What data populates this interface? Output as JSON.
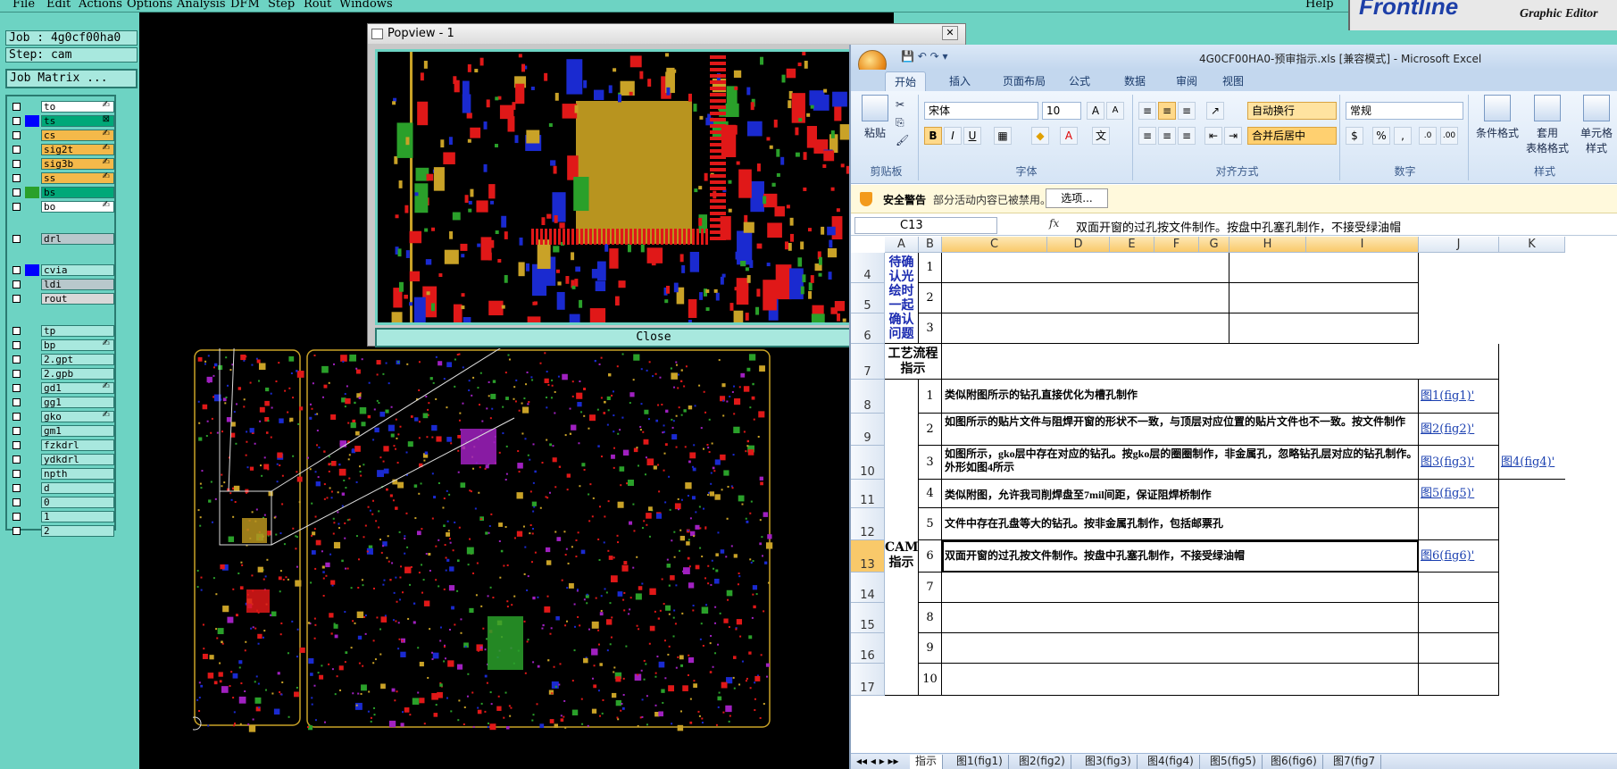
{
  "cam": {
    "menu": [
      "File",
      "Edit",
      "Actions",
      "Options",
      "Analysis",
      "DFM",
      "Step",
      "Rout",
      "Windows"
    ],
    "help": "Help",
    "brand": {
      "logo": "Frontline",
      "subtitle": "Graphic Editor"
    },
    "job_label": "Job : 4g0cf00ha0",
    "step_label": "Step: cam",
    "job_matrix": "Job Matrix ...",
    "layers": [
      {
        "name": "to",
        "color": "#ffffff",
        "mark": "✍"
      },
      {
        "name": "ts",
        "color": "#00a878",
        "mark": "⊠"
      },
      {
        "name": "cs",
        "color": "#f4b94a",
        "mark": "✍"
      },
      {
        "name": "sig2t",
        "color": "#f4b94a",
        "mark": "✍"
      },
      {
        "name": "sig3b",
        "color": "#f4b94a",
        "mark": "✍"
      },
      {
        "name": "ss",
        "color": "#f4b94a",
        "mark": "✍"
      },
      {
        "name": "bs",
        "color": "#00a878",
        "mark": ""
      },
      {
        "name": "bo",
        "color": "#ffffff",
        "mark": "✍"
      },
      {
        "name": "drl",
        "color": "#b8c8cc",
        "mark": ""
      },
      {
        "name": "cvia",
        "color": "#a8e8de",
        "mark": ""
      },
      {
        "name": "ldi",
        "color": "#b8c8cc",
        "mark": ""
      },
      {
        "name": "rout",
        "color": "#d8d8d8",
        "mark": ""
      },
      {
        "name": "tp",
        "color": "#a8e8de",
        "mark": ""
      },
      {
        "name": "bp",
        "color": "#a8e8de",
        "mark": "✍"
      },
      {
        "name": "2.gpt",
        "color": "#a8e8de",
        "mark": ""
      },
      {
        "name": "2.gpb",
        "color": "#a8e8de",
        "mark": ""
      },
      {
        "name": "gd1",
        "color": "#a8e8de",
        "mark": "✍"
      },
      {
        "name": "gg1",
        "color": "#a8e8de",
        "mark": ""
      },
      {
        "name": "gko",
        "color": "#a8e8de",
        "mark": "✍"
      },
      {
        "name": "gm1",
        "color": "#a8e8de",
        "mark": ""
      },
      {
        "name": "fzkdrl",
        "color": "#a8e8de",
        "mark": ""
      },
      {
        "name": "ydkdrl",
        "color": "#a8e8de",
        "mark": ""
      },
      {
        "name": "npth",
        "color": "#a8e8de",
        "mark": ""
      },
      {
        "name": "d",
        "color": "#a8e8de",
        "mark": ""
      },
      {
        "name": "0",
        "color": "#a8e8de",
        "mark": ""
      },
      {
        "name": "1",
        "color": "#a8e8de",
        "mark": ""
      },
      {
        "name": "2",
        "color": "#a8e8de",
        "mark": ""
      }
    ],
    "popview": {
      "title": "Popview - 1",
      "close": "Close"
    }
  },
  "excel": {
    "title": "4G0CF00HA0-预审指示.xls  [兼容模式]  -  Microsoft Excel",
    "tabs": [
      "开始",
      "插入",
      "页面布局",
      "公式",
      "数据",
      "审阅",
      "视图"
    ],
    "ribbon": {
      "clipboard": {
        "paste": "粘贴",
        "label": "剪贴板"
      },
      "font": {
        "name": "宋体",
        "size": "10",
        "label": "字体"
      },
      "align": {
        "wrap": "自动换行",
        "merge": "合并后居中",
        "label": "对齐方式"
      },
      "number": {
        "format": "常规",
        "label": "数字"
      },
      "styles": {
        "cond": "条件格式",
        "table1": "套用",
        "table2": "表格格式",
        "cell1": "单元格",
        "cell2": "样式",
        "label": "样式"
      }
    },
    "security": {
      "title": "安全警告",
      "text": "部分活动内容已被禁用。",
      "button": "选项..."
    },
    "formula": {
      "cell": "C13",
      "fx": "fx",
      "value": "双面开窗的过孔按文件制作。按盘中孔塞孔制作，不接受绿油帽"
    },
    "columns": [
      "A",
      "B",
      "C",
      "D",
      "E",
      "F",
      "G",
      "H",
      "I",
      "J",
      "K"
    ],
    "rows": {
      "numbers": [
        "4",
        "5",
        "6",
        "7",
        "8",
        "9",
        "10",
        "11",
        "12",
        "13",
        "14",
        "15",
        "16",
        "17"
      ],
      "confirm_label": "待确认光绘时一起确认问题",
      "confirm_nums": [
        "1",
        "2",
        "3"
      ],
      "process_label": "工艺流程指示",
      "cam_label": "CAM指示",
      "cam_items": [
        {
          "n": "1",
          "text": "类似附图所示的钻孔直接优化为槽孔制作",
          "link": "图1(fig1)'",
          "link2": ""
        },
        {
          "n": "2",
          "text": "如图所示的贴片文件与阻焊开窗的形状不一致，与顶层对应位置的贴片文件也不一致。按文件制作",
          "link": "图2(fig2)'",
          "link2": ""
        },
        {
          "n": "3",
          "text": "如图所示，gko层中存在对应的钻孔。按gko层的圈圈制作，非金属孔，忽略钻孔层对应的钻孔制作。外形如图4所示",
          "link": "图3(fig3)'",
          "link2": "图4(fig4)'"
        },
        {
          "n": "4",
          "text": "类似附图，允许我司削焊盘至7mil间距，保证阻焊桥制作",
          "link": "图5(fig5)'",
          "link2": ""
        },
        {
          "n": "5",
          "text": "文件中存在孔盘等大的钻孔。按非金属孔制作，包括邮票孔",
          "link": "",
          "link2": ""
        },
        {
          "n": "6",
          "text": "双面开窗的过孔按文件制作。按盘中孔塞孔制作，不接受绿油帽",
          "link": "图6(fig6)'",
          "link2": ""
        },
        {
          "n": "7",
          "text": "",
          "link": "",
          "link2": ""
        },
        {
          "n": "8",
          "text": "",
          "link": "",
          "link2": ""
        },
        {
          "n": "9",
          "text": "",
          "link": "",
          "link2": ""
        },
        {
          "n": "10",
          "text": "",
          "link": "",
          "link2": ""
        }
      ]
    },
    "sheet_tabs": [
      "指示",
      "图1(fig1)",
      "图2(fig2)",
      "图3(fig3)",
      "图4(fig4)",
      "图5(fig5)",
      "图6(fig6)",
      "图7(fig7"
    ]
  }
}
